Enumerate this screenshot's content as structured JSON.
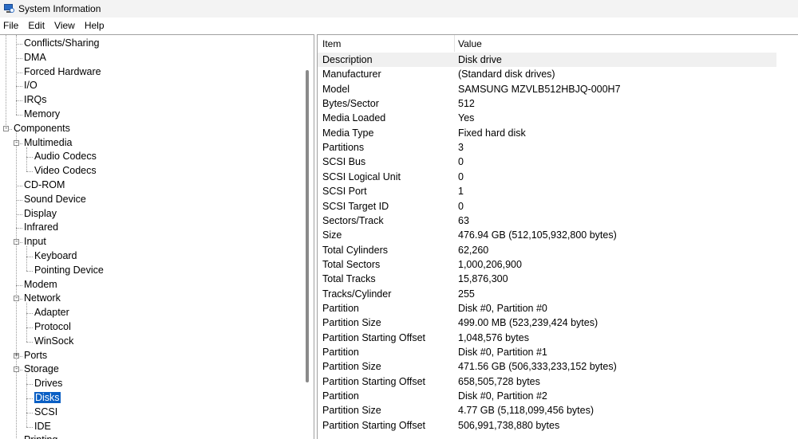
{
  "window": {
    "title": "System Information"
  },
  "menu": [
    "File",
    "Edit",
    "View",
    "Help"
  ],
  "tree": [
    {
      "label": "Conflicts/Sharing",
      "level": 2
    },
    {
      "label": "DMA",
      "level": 2
    },
    {
      "label": "Forced Hardware",
      "level": 2
    },
    {
      "label": "I/O",
      "level": 2
    },
    {
      "label": "IRQs",
      "level": 2
    },
    {
      "label": "Memory",
      "level": 2
    },
    {
      "label": "Components",
      "level": 1,
      "expander": "−"
    },
    {
      "label": "Multimedia",
      "level": 2,
      "expander": "−"
    },
    {
      "label": "Audio Codecs",
      "level": 3
    },
    {
      "label": "Video Codecs",
      "level": 3
    },
    {
      "label": "CD-ROM",
      "level": 2
    },
    {
      "label": "Sound Device",
      "level": 2
    },
    {
      "label": "Display",
      "level": 2
    },
    {
      "label": "Infrared",
      "level": 2
    },
    {
      "label": "Input",
      "level": 2,
      "expander": "−"
    },
    {
      "label": "Keyboard",
      "level": 3
    },
    {
      "label": "Pointing Device",
      "level": 3
    },
    {
      "label": "Modem",
      "level": 2
    },
    {
      "label": "Network",
      "level": 2,
      "expander": "−"
    },
    {
      "label": "Adapter",
      "level": 3
    },
    {
      "label": "Protocol",
      "level": 3
    },
    {
      "label": "WinSock",
      "level": 3
    },
    {
      "label": "Ports",
      "level": 2,
      "expander": "+"
    },
    {
      "label": "Storage",
      "level": 2,
      "expander": "−"
    },
    {
      "label": "Drives",
      "level": 3
    },
    {
      "label": "Disks",
      "level": 3,
      "selected": true
    },
    {
      "label": "SCSI",
      "level": 3
    },
    {
      "label": "IDE",
      "level": 3
    },
    {
      "label": "Printing",
      "level": 2
    }
  ],
  "grid": {
    "headers": {
      "item": "Item",
      "value": "Value"
    },
    "rows": [
      {
        "item": "Description",
        "value": "Disk drive"
      },
      {
        "item": "Manufacturer",
        "value": "(Standard disk drives)"
      },
      {
        "item": "Model",
        "value": "SAMSUNG MZVLB512HBJQ-000H7"
      },
      {
        "item": "Bytes/Sector",
        "value": "512"
      },
      {
        "item": "Media Loaded",
        "value": "Yes"
      },
      {
        "item": "Media Type",
        "value": "Fixed hard disk"
      },
      {
        "item": "Partitions",
        "value": "3"
      },
      {
        "item": "SCSI Bus",
        "value": "0"
      },
      {
        "item": "SCSI Logical Unit",
        "value": "0"
      },
      {
        "item": "SCSI Port",
        "value": "1"
      },
      {
        "item": "SCSI Target ID",
        "value": "0"
      },
      {
        "item": "Sectors/Track",
        "value": "63"
      },
      {
        "item": "Size",
        "value": "476.94 GB (512,105,932,800 bytes)"
      },
      {
        "item": "Total Cylinders",
        "value": "62,260"
      },
      {
        "item": "Total Sectors",
        "value": "1,000,206,900"
      },
      {
        "item": "Total Tracks",
        "value": "15,876,300"
      },
      {
        "item": "Tracks/Cylinder",
        "value": "255"
      },
      {
        "item": "Partition",
        "value": "Disk #0, Partition #0"
      },
      {
        "item": "Partition Size",
        "value": "499.00 MB (523,239,424 bytes)"
      },
      {
        "item": "Partition Starting Offset",
        "value": "1,048,576 bytes"
      },
      {
        "item": "Partition",
        "value": "Disk #0, Partition #1"
      },
      {
        "item": "Partition Size",
        "value": "471.56 GB (506,333,233,152 bytes)"
      },
      {
        "item": "Partition Starting Offset",
        "value": "658,505,728 bytes"
      },
      {
        "item": "Partition",
        "value": "Disk #0, Partition #2"
      },
      {
        "item": "Partition Size",
        "value": "4.77 GB (5,118,099,456 bytes)"
      },
      {
        "item": "Partition Starting Offset",
        "value": "506,991,738,880 bytes"
      }
    ]
  },
  "colors": {
    "selection": "#0a5fc4",
    "row_highlight": "#f0f0f0"
  }
}
